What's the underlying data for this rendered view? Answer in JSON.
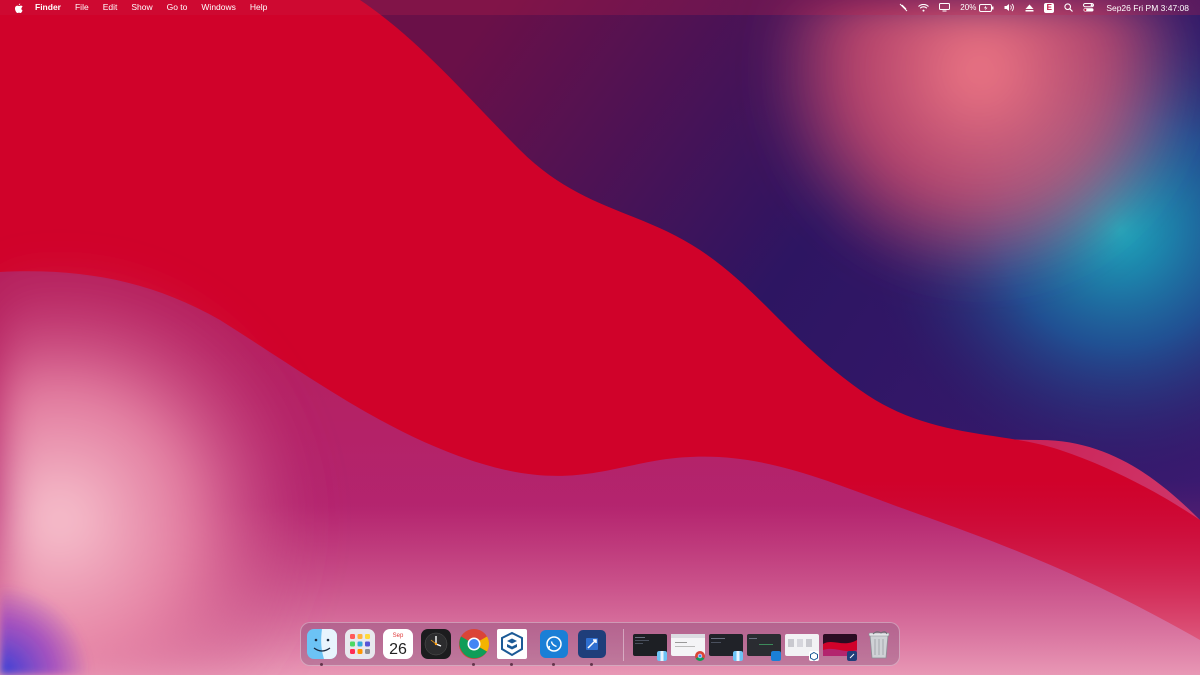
{
  "menubar": {
    "apple_icon": "apple-icon",
    "app_name": "Finder",
    "menus": [
      "File",
      "Edit",
      "Show",
      "Go to",
      "Windows",
      "Help"
    ],
    "status": {
      "battery_percent": "20%",
      "datetime": "Sep26 Fri PM 3:47:08",
      "input_source": "E",
      "icons": [
        "pen-slash-icon",
        "wifi-icon",
        "display-icon",
        "battery-icon",
        "volume-icon",
        "eject-icon",
        "input-source-icon",
        "search-icon",
        "control-center-icon"
      ]
    }
  },
  "dock": {
    "apps": [
      {
        "name": "Finder",
        "icon": "finder-icon",
        "running": true
      },
      {
        "name": "Launchpad",
        "icon": "launchpad-icon",
        "running": false
      },
      {
        "name": "Calendar",
        "icon": "calendar-icon",
        "month": "Sep",
        "day": "26",
        "running": false
      },
      {
        "name": "Clock",
        "icon": "clock-icon",
        "running": false
      },
      {
        "name": "Google Chrome",
        "icon": "chrome-icon",
        "running": true
      },
      {
        "name": "SketchUp",
        "icon": "sketchup-icon",
        "running": true
      },
      {
        "name": "WhatsApp",
        "icon": "whatsapp-icon",
        "running": true
      },
      {
        "name": "Preview",
        "icon": "preview-icon",
        "running": true
      }
    ],
    "minimized_windows": [
      {
        "icon": "window-thumbnail-icon",
        "badge": "finder"
      },
      {
        "icon": "window-thumbnail-icon",
        "badge": "chrome"
      },
      {
        "icon": "window-thumbnail-icon",
        "badge": "finder"
      },
      {
        "icon": "window-thumbnail-icon",
        "badge": "app"
      },
      {
        "icon": "window-thumbnail-icon",
        "badge": "sketchup"
      },
      {
        "icon": "window-thumbnail-icon",
        "badge": "preview"
      }
    ],
    "trash_icon": "trash-icon"
  },
  "colors": {
    "wallpaper_red": "#d0022a",
    "wallpaper_navy": "#2a1660",
    "wallpaper_teal": "#18a0b8",
    "wallpaper_pink": "#f29ab0"
  }
}
